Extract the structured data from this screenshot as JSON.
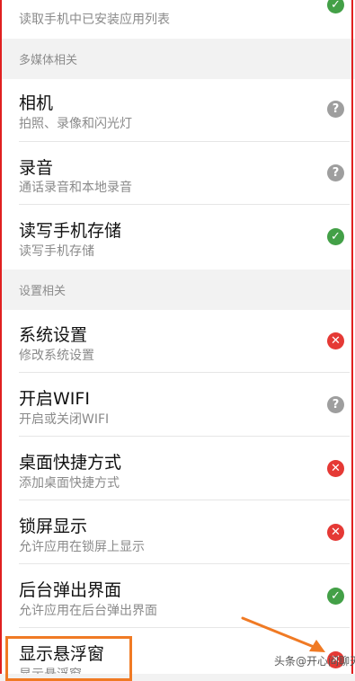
{
  "top_row": {
    "subtitle": "读取手机中已安装应用列表"
  },
  "sections": {
    "media": "多媒体相关",
    "settings": "设置相关"
  },
  "items": [
    {
      "title": "相机",
      "subtitle": "拍照、录像和闪光灯"
    },
    {
      "title": "录音",
      "subtitle": "通话录音和本地录音"
    },
    {
      "title": "读写手机存储",
      "subtitle": "读写手机存储"
    },
    {
      "title": "系统设置",
      "subtitle": "修改系统设置"
    },
    {
      "title": "开启WIFI",
      "subtitle": "开启或关闭WIFI"
    },
    {
      "title": "桌面快捷方式",
      "subtitle": "添加桌面快捷方式"
    },
    {
      "title": "锁屏显示",
      "subtitle": "允许应用在锁屏上显示"
    },
    {
      "title": "后台弹出界面",
      "subtitle": "允许应用在后台弹出界面"
    },
    {
      "title": "显示悬浮窗",
      "subtitle": "显示悬浮窗"
    }
  ],
  "status_glyphs": {
    "ok": "✓",
    "deny": "✕",
    "ask": "?"
  },
  "colors": {
    "ok": "#43a047",
    "deny": "#e53935",
    "ask": "#9e9e9e",
    "annotation": "#f07a24"
  },
  "watermark": "头条@开心间聊天"
}
